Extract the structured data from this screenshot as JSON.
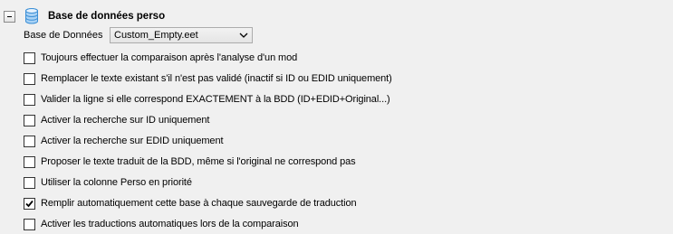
{
  "section": {
    "title": "Base de données perso",
    "collapse_icon": "minus-icon",
    "db_icon": "database-icon"
  },
  "database": {
    "label": "Base de Données",
    "selected": "Custom_Empty.eet"
  },
  "options": [
    {
      "label": "Toujours effectuer la comparaison après l'analyse d'un mod",
      "checked": false
    },
    {
      "label": "Remplacer le texte existant s'il n'est pas validé (inactif si ID ou EDID uniquement)",
      "checked": false
    },
    {
      "label": "Valider la ligne si elle correspond EXACTEMENT à la BDD (ID+EDID+Original...)",
      "checked": false
    },
    {
      "label": "Activer la recherche sur ID uniquement",
      "checked": false
    },
    {
      "label": "Activer la recherche sur EDID uniquement",
      "checked": false
    },
    {
      "label": "Proposer le texte traduit de la BDD, même si l'original ne correspond pas",
      "checked": false
    },
    {
      "label": "Utiliser la colonne Perso en priorité",
      "checked": false
    },
    {
      "label": "Remplir automatiquement cette base à chaque sauvegarde de traduction",
      "checked": true
    },
    {
      "label": "Activer les traductions automatiques lors de la comparaison",
      "checked": false
    }
  ],
  "colors": {
    "background": "#f0f0f0",
    "db_icon_blue": "#3b8fd6"
  }
}
